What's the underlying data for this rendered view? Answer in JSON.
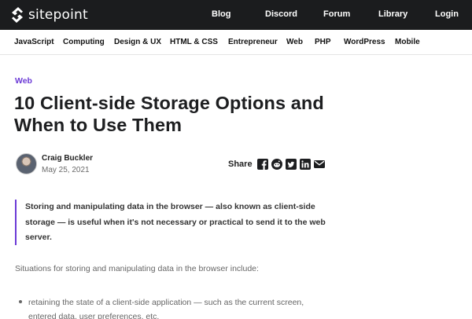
{
  "header": {
    "logo_text": "sitepoint",
    "nav": [
      "Blog",
      "Discord",
      "Forum",
      "Library",
      "Login"
    ]
  },
  "categories": [
    "JavaScript",
    "Computing",
    "Design & UX",
    "HTML & CSS",
    "Entrepreneur",
    "Web",
    "PHP",
    "WordPress",
    "Mobile"
  ],
  "article": {
    "category": "Web",
    "title": "10 Client-side Storage Options and When to Use Them",
    "author": "Craig Buckler",
    "date": "May 25, 2021",
    "share_label": "Share",
    "share_icons": [
      "facebook-icon",
      "reddit-icon",
      "twitter-icon",
      "linkedin-icon",
      "email-icon"
    ],
    "lede": "Storing and manipulating data in the browser — also known as client-side storage — is useful when it's not necessary or practical to send it to the web server.",
    "paragraph": "Situations for storing and manipulating data in the browser include:",
    "bullets": [
      "retaining the state of a client-side application — such as the current screen, entered data, user preferences, etc."
    ]
  },
  "colors": {
    "topbar": "#1b1c1e",
    "accent": "#6c3bd6"
  }
}
